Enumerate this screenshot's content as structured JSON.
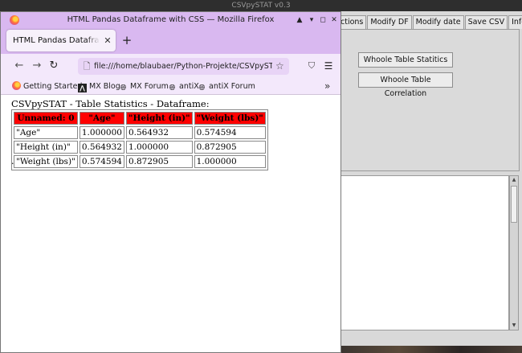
{
  "background_app": {
    "window_title": "CSVpySTAT v0.3",
    "tabs": [
      "ctions",
      "Modify DF",
      "Modify date",
      "Save CSV",
      "Info"
    ],
    "buttons": {
      "table_statistics": "Whoole Table Statitics",
      "table_correlation": "Whoole Table Correlation"
    }
  },
  "browser": {
    "window_title": "HTML Pandas Dataframe with CSS — Mozilla Firefox",
    "tab_label": "HTML Pandas Dataframe wit",
    "url": "file:///home/blaubaer/Python-Projekte/CSVpySTAT/my",
    "bookmarks": [
      {
        "label": "Getting Started",
        "icon": "firefox-icon"
      },
      {
        "label": "MX Blog",
        "icon": "mx-logo-icon"
      },
      {
        "label": "MX Forum",
        "icon": "globe-icon"
      },
      {
        "label": "antiX",
        "icon": "globe-icon"
      },
      {
        "label": "antiX Forum",
        "icon": "globe-icon"
      }
    ]
  },
  "page": {
    "heading": "CSVpySTAT - Table Statistics - Dataframe:",
    "table": {
      "headers": [
        "Unnamed: 0",
        "\"Age\"",
        "\"Height (in)\"",
        "\"Weight (lbs)\""
      ],
      "rows": [
        [
          "\"Age\"",
          "1.000000",
          "0.564932",
          "0.574594"
        ],
        [
          "\"Height (in)\"",
          "0.564932",
          "1.000000",
          "0.872905"
        ],
        [
          "\"Weight (lbs)\"",
          "0.574594",
          "0.872905",
          "1.000000"
        ]
      ]
    },
    "trailing_text": "."
  },
  "colors": {
    "table_header_bg": "#ff0000",
    "browser_chrome": "#d9b8f0",
    "toolbar": "#f3e8fb"
  }
}
